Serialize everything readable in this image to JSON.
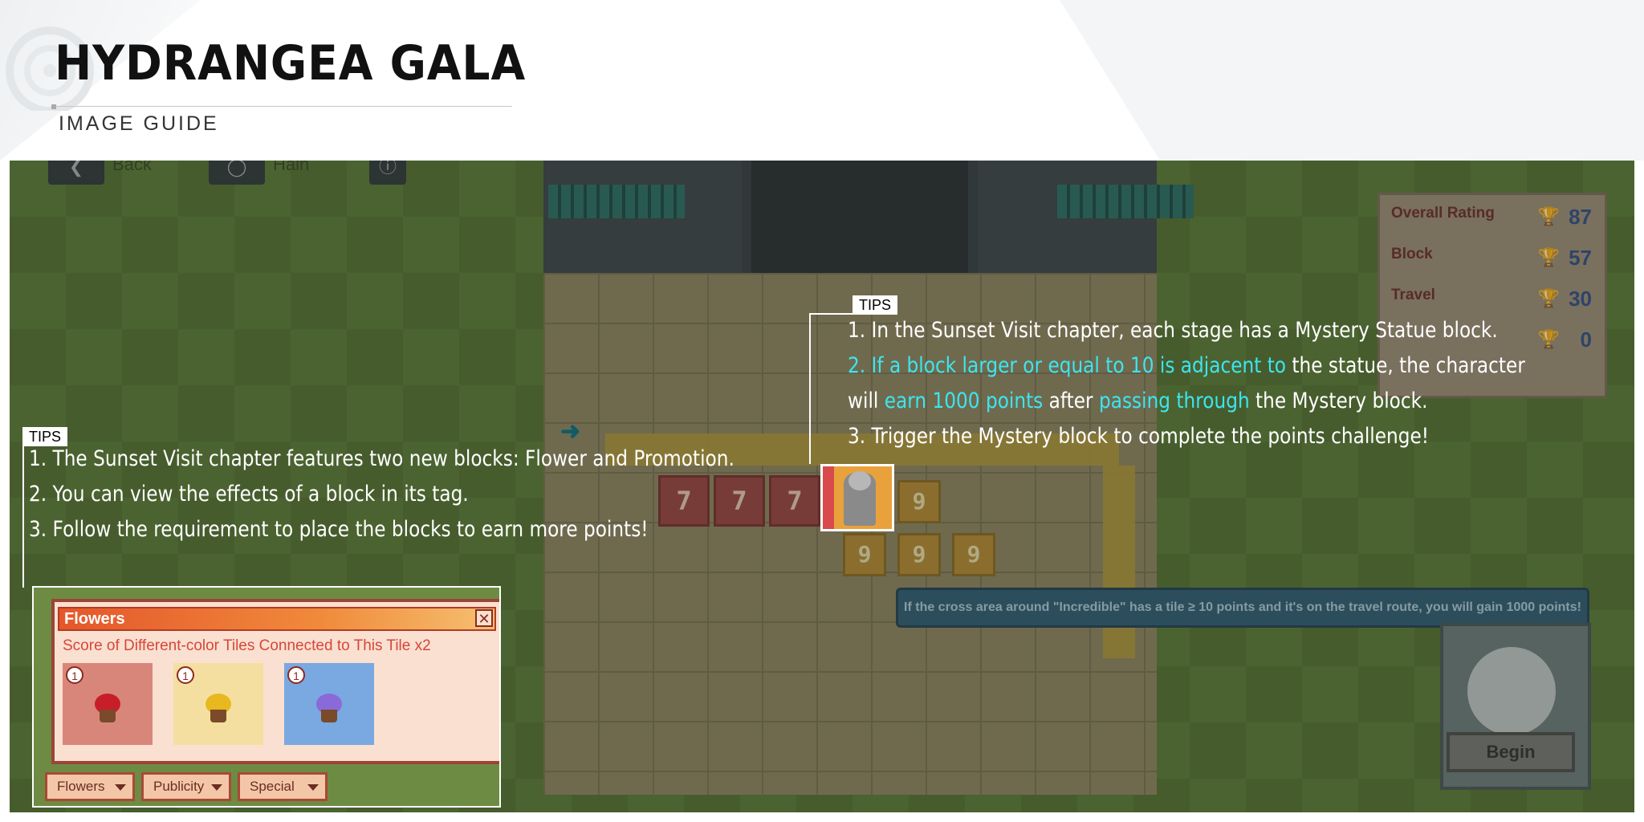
{
  "header": {
    "title": "HYDRANGEA GALA",
    "subtitle": "IMAGE GUIDE"
  },
  "top_buttons": [
    {
      "icon": "back-arrow-icon",
      "label": "Back"
    },
    {
      "icon": "circle-icon",
      "label": "Hain"
    },
    {
      "icon": "info-icon",
      "label": ""
    }
  ],
  "rating_panel": {
    "rows": [
      {
        "label": "Overall Rating",
        "value": "87"
      },
      {
        "label": "Block",
        "value": "57"
      },
      {
        "label": "Travel",
        "value": "30"
      },
      {
        "label": "",
        "value": "0"
      }
    ]
  },
  "board": {
    "red_tiles": [
      "7",
      "7",
      "7"
    ],
    "gold_tiles_top": [
      "9"
    ],
    "gold_tiles_bottom": [
      "9",
      "9",
      "9"
    ]
  },
  "hint_bar": "If the cross area around \"Incredible\" has a tile ≥ 10 points and it's on the travel route, you will gain 1000 points!",
  "begin_button": "Begin",
  "flower_panel": {
    "title": "Flowers",
    "description": "Score of Different-color Tiles Connected to This Tile x2",
    "cards": [
      {
        "count": "1",
        "color": "#d9867a",
        "flower_color": "#c81e2a"
      },
      {
        "count": "1",
        "color": "#f5dfa0",
        "flower_color": "#e8b820"
      },
      {
        "count": "1",
        "color": "#7aa8e0",
        "flower_color": "#8a6ad8"
      }
    ],
    "tabs": [
      "Flowers",
      "Publicity",
      "Special"
    ]
  },
  "tips_left": {
    "label": "TIPS",
    "lines": [
      "1. The Sunset Visit chapter features two new blocks: Flower and Promotion.",
      "2. You can view the effects of a block in its tag.",
      "3. Follow the requirement to place the blocks to earn more points!"
    ]
  },
  "tips_right": {
    "label": "TIPS",
    "line1": "1. In the Sunset Visit chapter, each stage has a Mystery Statue block.",
    "line2_a": "2. If a block larger or equal to 10 is adjacent to",
    "line2_b": " the statue, the character",
    "line3_a": "will ",
    "line3_b": "earn 1000 points",
    "line3_c": " after ",
    "line3_d": "passing through",
    "line3_e": " the Mystery block.",
    "line4": "3. Trigger the Mystery block to complete the points challenge!"
  },
  "colors": {
    "highlight": "#3ce6f0",
    "panel_title": "#e5562b",
    "panel_text": "#d9463a"
  }
}
